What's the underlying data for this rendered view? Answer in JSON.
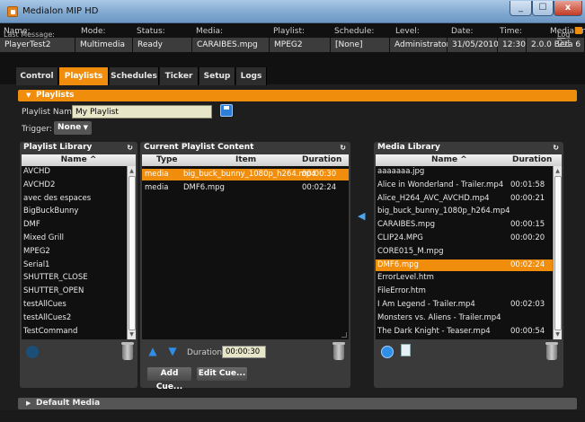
{
  "window": {
    "title": "Medialon MIP HD",
    "min": "_",
    "max": "☐",
    "close": "x"
  },
  "status": {
    "labels": [
      "Name:",
      "Mode:",
      "Status:",
      "Media:",
      "Playlist:",
      "Schedule:",
      "Level:",
      "Date:",
      "Time:",
      "Medialon"
    ],
    "values": [
      "PlayerTest2",
      "Multimedia",
      "Ready",
      "CARAIBES.mpg",
      "MPEG2",
      "[None]",
      "Administrator",
      "31/05/2010",
      "12:30",
      "2.0.0 Beta 6"
    ],
    "last_message_label": "Last Message:",
    "logout": "Log Out"
  },
  "tabs": [
    "Control",
    "Playlists",
    "Schedules",
    "Ticker",
    "Setup",
    "Logs"
  ],
  "active_tab": "Playlists",
  "playlists_section": {
    "title": "Playlists",
    "name_label": "Playlist Name:",
    "name_value": "My Playlist",
    "trigger_label": "Trigger:",
    "trigger_value": "None"
  },
  "library": {
    "title": "Playlist Library",
    "column": "Name ^",
    "items": [
      "AVCHD",
      "AVCHD2",
      "avec des espaces",
      "BigBuckBunny",
      "DMF",
      "Mixed Grill",
      "MPEG2",
      "Serial1",
      "SHUTTER_CLOSE",
      "SHUTTER_OPEN",
      "testAllCues",
      "testAllCues2",
      "TestCommand"
    ]
  },
  "playlist": {
    "title": "Current Playlist Content",
    "columns": [
      "Type",
      "Item",
      "Duration"
    ],
    "rows": [
      {
        "type": "media",
        "item": "big_buck_bunny_1080p_h264.mp4",
        "duration": "00:00:30"
      },
      {
        "type": "media",
        "item": "DMF6.mpg",
        "duration": "00:02:24"
      }
    ],
    "duration_label": "Duration:",
    "duration_value": "00:00:30",
    "add_cue": "Add Cue...",
    "edit_cue": "Edit Cue..."
  },
  "media": {
    "title": "Media Library",
    "columns": [
      "Name ^",
      "Duration"
    ],
    "rows": [
      {
        "name": "aaaaaaa.jpg",
        "duration": ""
      },
      {
        "name": "Alice in Wonderland - Trailer.mp4",
        "duration": "00:01:58"
      },
      {
        "name": "Alice_H264_AVC_AVCHD.mp4",
        "duration": "00:00:21"
      },
      {
        "name": "big_buck_bunny_1080p_h264.mp4",
        "duration": ""
      },
      {
        "name": "CARAIBES.mpg",
        "duration": "00:00:15"
      },
      {
        "name": "CLIP24.MPG",
        "duration": "00:00:20"
      },
      {
        "name": "CORE015_M.mpg",
        "duration": ""
      },
      {
        "name": "DMF6.mpg",
        "duration": "00:02:24"
      },
      {
        "name": "ErrorLevel.htm",
        "duration": ""
      },
      {
        "name": "FileError.htm",
        "duration": ""
      },
      {
        "name": "I Am Legend - Trailer.mp4",
        "duration": "00:02:03"
      },
      {
        "name": "Monsters vs. Aliens - Trailer.mp4",
        "duration": ""
      },
      {
        "name": "The Dark Knight - Teaser.mp4",
        "duration": "00:00:54"
      }
    ],
    "selected": "DMF6.mpg"
  },
  "default_media_section": {
    "title": "Default Media"
  },
  "colors": {
    "accent": "#f08d0c",
    "panel": "#3a3a3a",
    "list_bg": "#101010"
  }
}
